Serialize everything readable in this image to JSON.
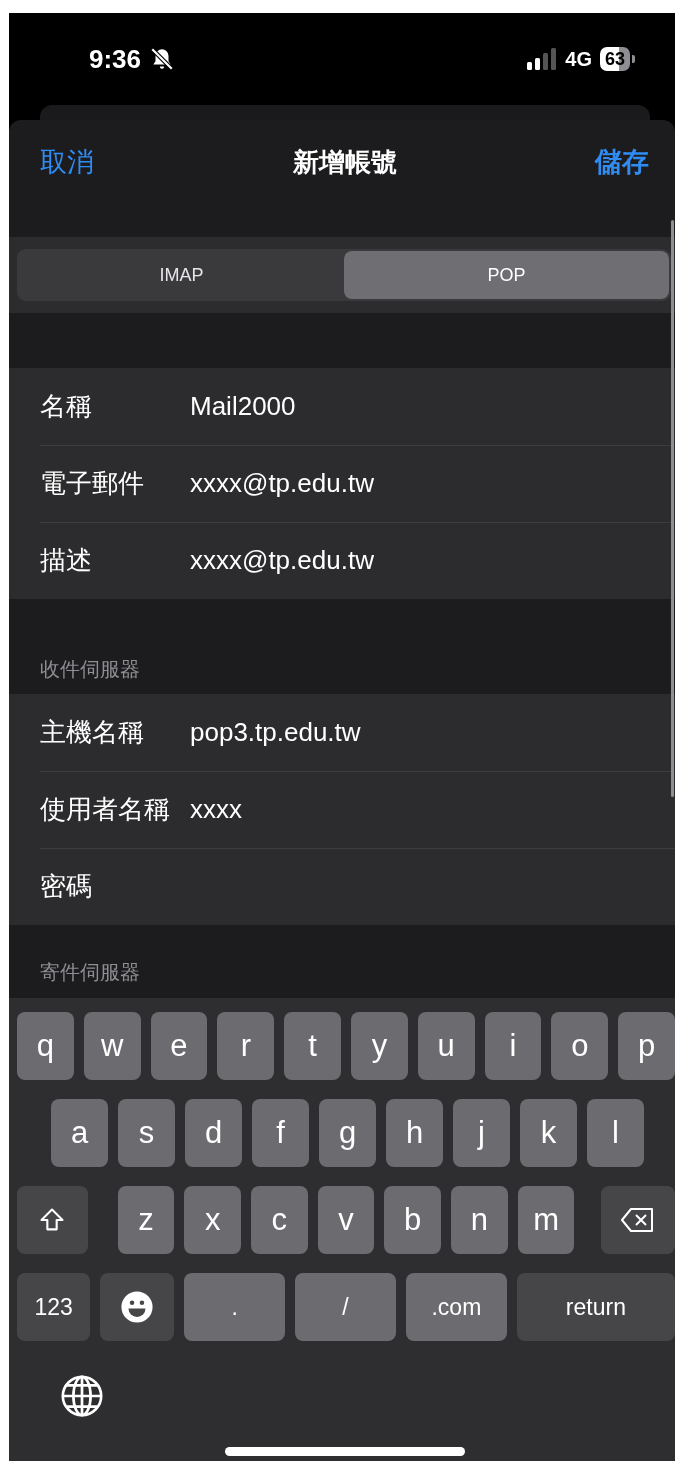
{
  "status_bar": {
    "time": "9:36",
    "silent": true,
    "network": "4G",
    "battery": "63"
  },
  "nav": {
    "cancel": "取消",
    "title": "新增帳號",
    "save": "儲存"
  },
  "segments": [
    {
      "label": "IMAP",
      "selected": false
    },
    {
      "label": "POP",
      "selected": true
    }
  ],
  "account_fields": [
    {
      "label": "名稱",
      "value": "Mail2000"
    },
    {
      "label": "電子郵件",
      "value": "xxxx@tp.edu.tw"
    },
    {
      "label": "描述",
      "value": "xxxx@tp.edu.tw"
    }
  ],
  "incoming": {
    "header": "收件伺服器",
    "fields": [
      {
        "label": "主機名稱",
        "value": "pop3.tp.edu.tw"
      },
      {
        "label": "使用者名稱",
        "value": "xxxx"
      },
      {
        "label": "密碼"
      }
    ]
  },
  "outgoing": {
    "header": "寄件伺服器"
  },
  "keyboard": {
    "letter_rows": [
      [
        {
          "kind": "letter",
          "label": "q"
        },
        {
          "kind": "letter",
          "label": "w"
        },
        {
          "kind": "letter",
          "label": "e"
        },
        {
          "kind": "letter",
          "label": "r"
        },
        {
          "kind": "letter",
          "label": "t"
        },
        {
          "kind": "letter",
          "label": "y"
        },
        {
          "kind": "letter",
          "label": "u"
        },
        {
          "kind": "letter",
          "label": "i"
        },
        {
          "kind": "letter",
          "label": "o"
        },
        {
          "kind": "letter",
          "label": "p"
        }
      ],
      [
        {
          "kind": "letter",
          "label": "a"
        },
        {
          "kind": "letter",
          "label": "s"
        },
        {
          "kind": "letter",
          "label": "d"
        },
        {
          "kind": "letter",
          "label": "f"
        },
        {
          "kind": "letter",
          "label": "g"
        },
        {
          "kind": "letter",
          "label": "h"
        },
        {
          "kind": "letter",
          "label": "j"
        },
        {
          "kind": "letter",
          "label": "k"
        },
        {
          "kind": "letter",
          "label": "l"
        }
      ],
      [
        {
          "kind": "shift"
        },
        {
          "kind": "letter",
          "label": "z"
        },
        {
          "kind": "letter",
          "label": "x"
        },
        {
          "kind": "letter",
          "label": "c"
        },
        {
          "kind": "letter",
          "label": "v"
        },
        {
          "kind": "letter",
          "label": "b"
        },
        {
          "kind": "letter",
          "label": "n"
        },
        {
          "kind": "letter",
          "label": "m"
        },
        {
          "kind": "delete"
        }
      ]
    ],
    "bottom_row": [
      {
        "kind": "function",
        "label": "123"
      },
      {
        "kind": "emoji"
      },
      {
        "kind": "wide",
        "label": "."
      },
      {
        "kind": "wide",
        "label": "/"
      },
      {
        "kind": "wide",
        "label": ".com"
      },
      {
        "kind": "return",
        "label": "return"
      }
    ]
  }
}
